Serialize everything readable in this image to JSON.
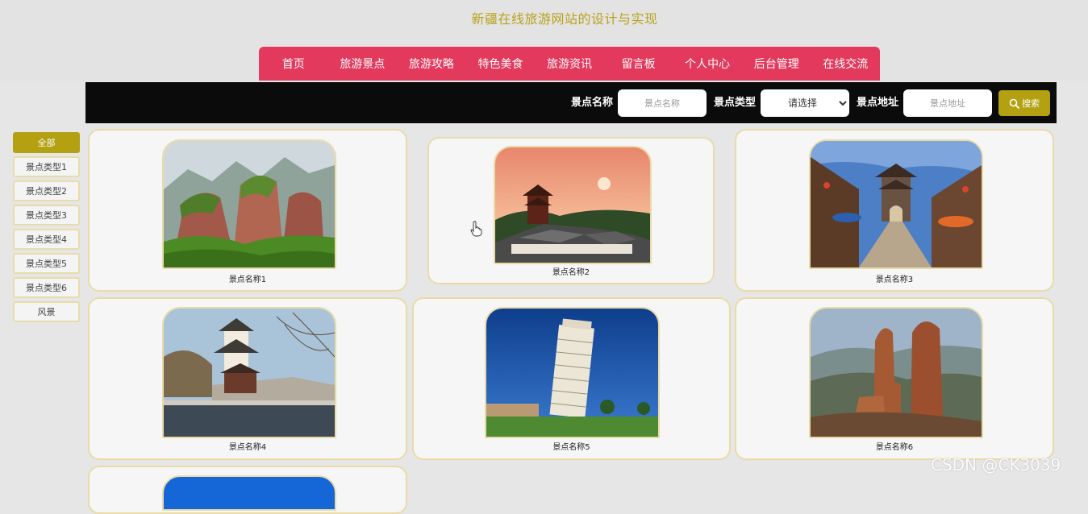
{
  "header": {
    "title": "新疆在线旅游网站的设计与实现",
    "nav": [
      "首页",
      "旅游景点",
      "旅游攻略",
      "特色美食",
      "旅游资讯",
      "留言板",
      "个人中心",
      "后台管理",
      "在线交流"
    ]
  },
  "search": {
    "name_label": "景点名称",
    "name_placeholder": "景点名称",
    "type_label": "景点类型",
    "type_selected": "请选择",
    "address_label": "景点地址",
    "address_placeholder": "景点地址",
    "button_label": "搜索",
    "button_icon": "search-icon"
  },
  "sidebar": {
    "items": [
      "全部",
      "景点类型1",
      "景点类型2",
      "景点类型3",
      "景点类型4",
      "景点类型5",
      "景点类型6",
      "风景"
    ],
    "active_index": 0
  },
  "cards": [
    {
      "caption": "景点名称1"
    },
    {
      "caption": "景点名称2"
    },
    {
      "caption": "景点名称3"
    },
    {
      "caption": "景点名称4"
    },
    {
      "caption": "景点名称5"
    },
    {
      "caption": "景点名称6"
    },
    {
      "caption": ""
    }
  ],
  "watermark": "CSDN @CK3039",
  "colors": {
    "nav_bg": "#e2395d",
    "accent": "#b3a112",
    "title": "#b9a21a",
    "search_bg": "#0b0b0b",
    "card_border": "#e9dba8"
  }
}
